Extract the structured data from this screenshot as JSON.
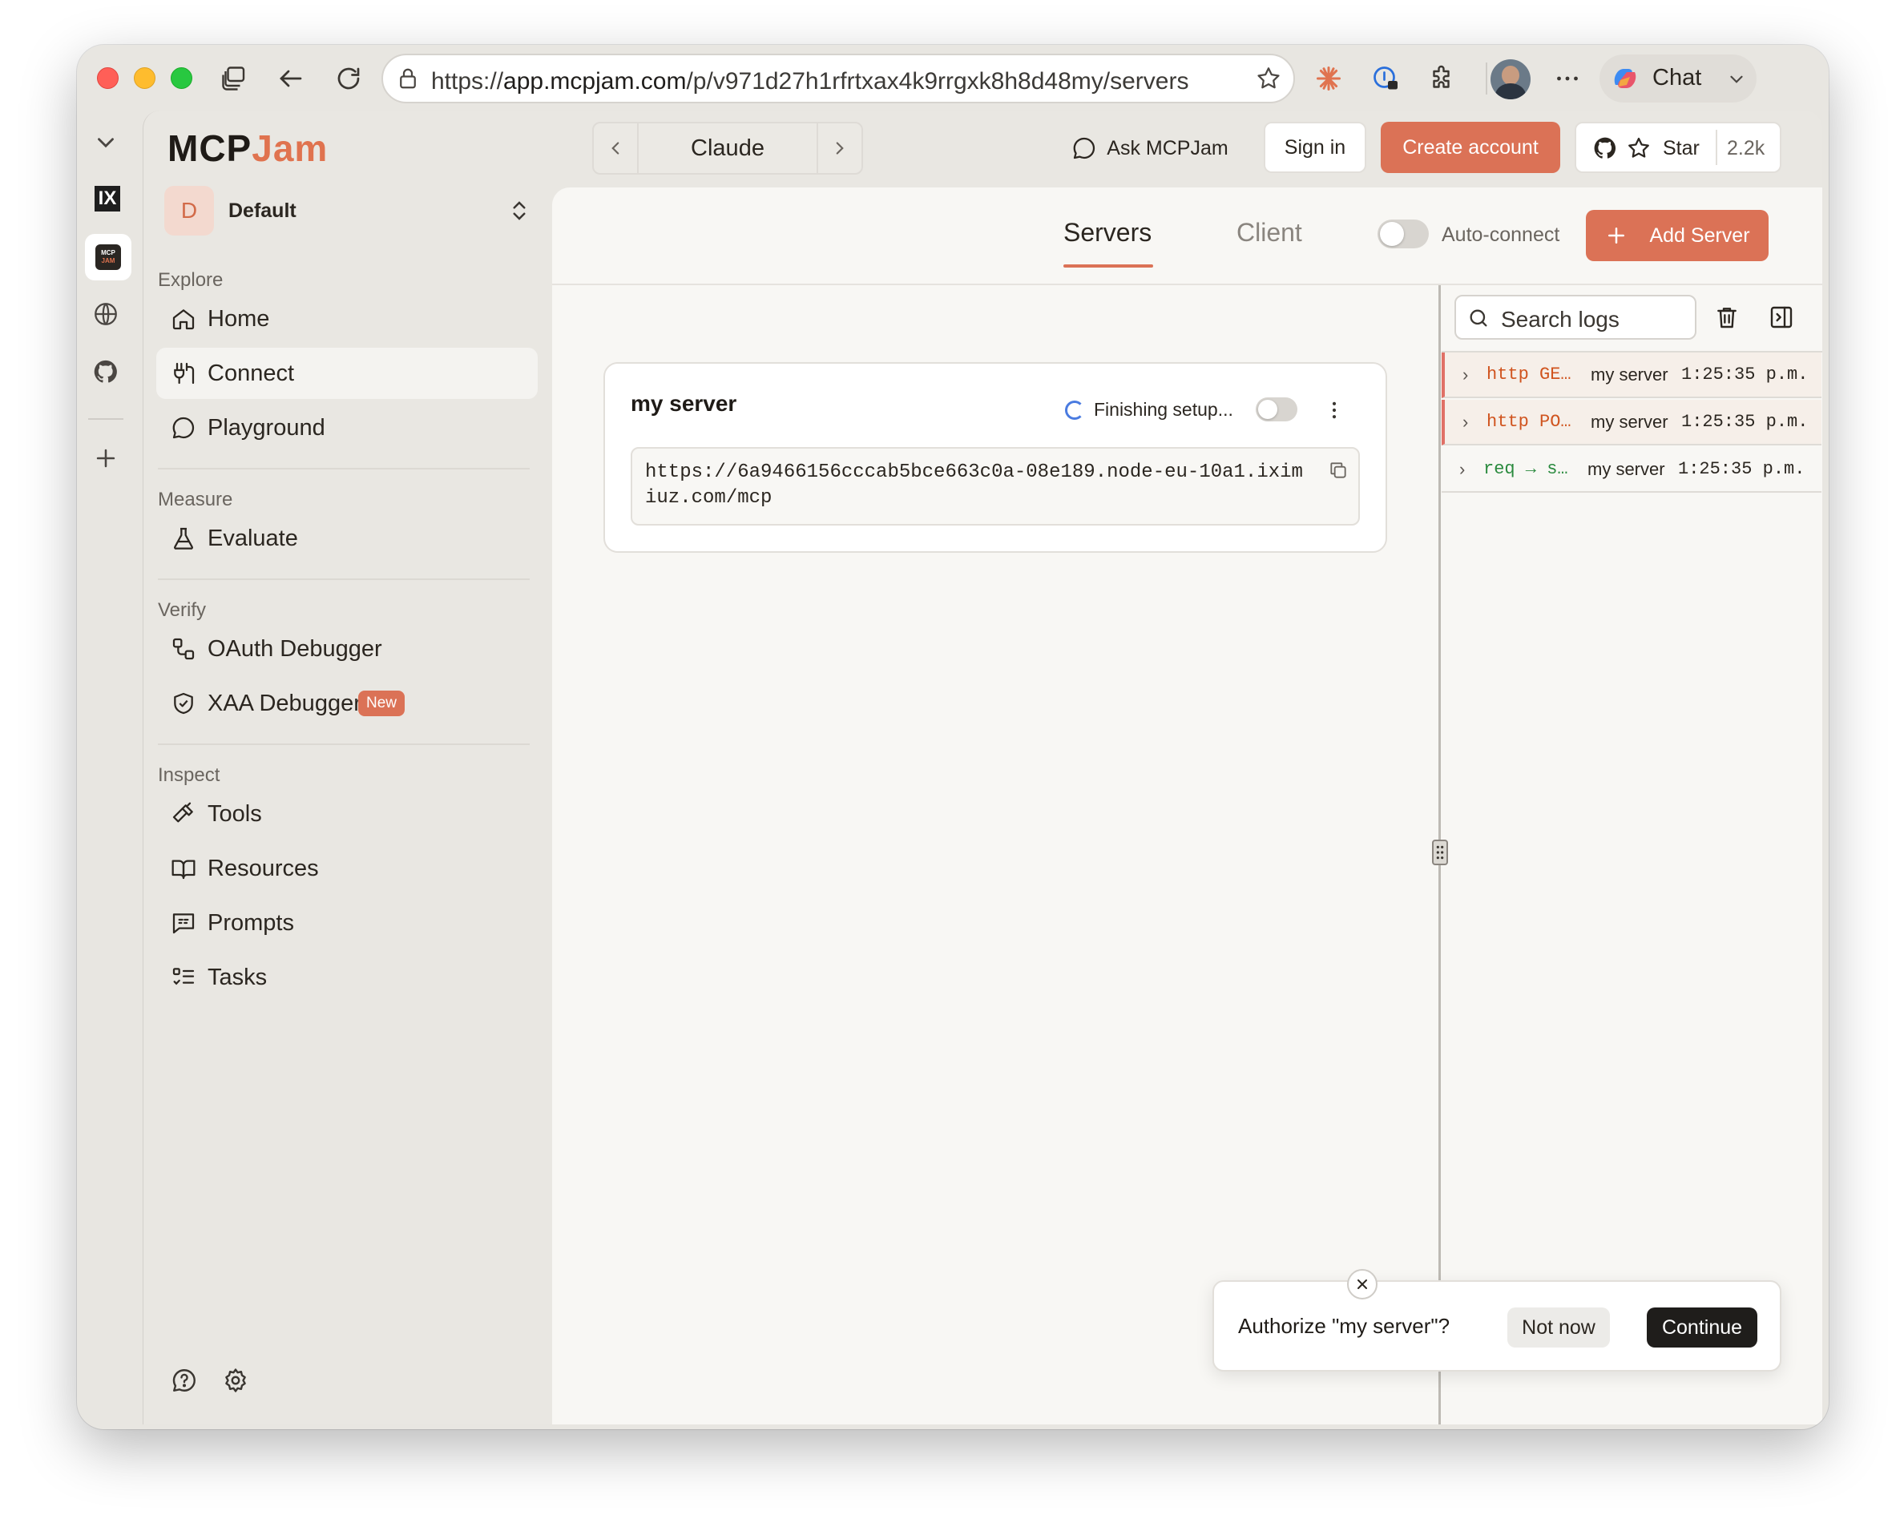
{
  "browser": {
    "url_scheme": "https://",
    "url_host": "app.mcpjam.com",
    "url_path": "/p/v971d27h1rfrtxax4k9rrgxk8h8d48my/servers",
    "chat_label": "Chat"
  },
  "rail": {
    "ix_label": "IX",
    "mcp_label_top": "MCP",
    "mcp_label_bottom": "JAM"
  },
  "app": {
    "brand_left": "MCP",
    "brand_right": "Jam",
    "brand_color_left": "#1f1b17",
    "brand_color_right": "#e0734f",
    "accent": "#db7256"
  },
  "workspace": {
    "initial": "D",
    "name": "Default"
  },
  "sidebar": {
    "sections": {
      "explore": "Explore",
      "measure": "Measure",
      "verify": "Verify",
      "inspect": "Inspect"
    },
    "items": {
      "home": "Home",
      "connect": "Connect",
      "playground": "Playground",
      "evaluate": "Evaluate",
      "oauth": "OAuth Debugger",
      "xaa": "XAA Debugger",
      "xaa_badge": "New",
      "tools": "Tools",
      "resources": "Resources",
      "prompts": "Prompts",
      "tasks": "Tasks"
    }
  },
  "header": {
    "client_name": "Claude",
    "ask_label": "Ask MCPJam",
    "sign_in": "Sign in",
    "create_account": "Create account",
    "star_label": "Star",
    "star_count": "2.2k"
  },
  "tabs": {
    "servers": "Servers",
    "client": "Client"
  },
  "toolbar": {
    "auto_connect": "Auto-connect",
    "add_server": "Add Server"
  },
  "server_card": {
    "name": "my server",
    "status": "Finishing setup...",
    "url_line1": "https://6a9466156cccab5bce663c0a-08e189.node-eu-10a1.ixim",
    "url_line2": "iuz.com/mcp"
  },
  "logs": {
    "search_placeholder": "Search logs",
    "rows": [
      {
        "kind": "http GE…",
        "server": "my server",
        "time": "1:25:35 p.m.",
        "color": "#d0541f"
      },
      {
        "kind": "http PO…",
        "server": "my server",
        "time": "1:25:35 p.m.",
        "color": "#d0541f"
      },
      {
        "kind": "req → s…",
        "server": "my server",
        "time": "1:25:35 p.m.",
        "color": "#2a8a3e"
      }
    ]
  },
  "toast": {
    "message": "Authorize \"my server\"?",
    "not_now": "Not now",
    "continue": "Continue"
  }
}
